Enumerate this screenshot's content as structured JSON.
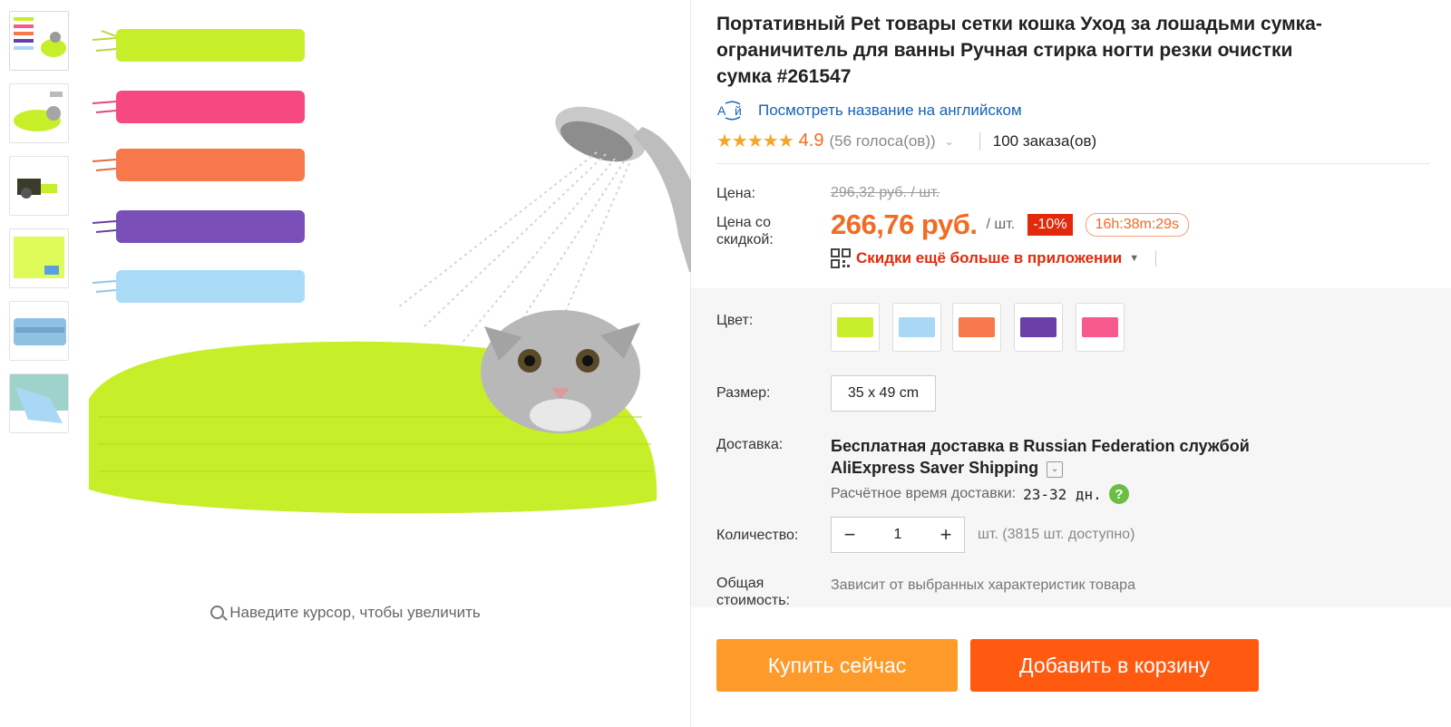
{
  "gallery": {
    "zoom_hint": "Наведите курсор, чтобы увеличить",
    "thumbnail_count": 6
  },
  "product": {
    "title": "Портативный Pet товары сетки кошка Уход за лошадьми сумка-ограничитель для ванны Ручная стирка ногти резки очистки сумка #261547",
    "translate_label": "Посмотреть название на английском",
    "rating_stars": "★★★★★",
    "rating_score": "4.9",
    "rating_votes": "(56 голоса(ов))",
    "orders": "100 заказа(ов)"
  },
  "pricing": {
    "price_label": "Цена:",
    "old_price": "296,32 руб. / шт.",
    "discount_label_line1": "Цена со",
    "discount_label_line2": "скидкой:",
    "price": "266,76 руб.",
    "unit": "/ шт.",
    "discount": "-10%",
    "timer": "16h:38m:29s",
    "app_promo": "Скидки ещё больше в приложении"
  },
  "options": {
    "color_label": "Цвет:",
    "colors": [
      "#c6ef2a",
      "#a9d8f5",
      "#f7784a",
      "#6a3fa8",
      "#f85a8d"
    ],
    "size_label": "Размер:",
    "size_value": "35 x 49 cm",
    "shipping_label": "Доставка:",
    "shipping_line1": "Бесплатная доставка в Russian Federation службой",
    "shipping_line2": "AliExpress Saver Shipping",
    "delivery_time_label": "Расчётное время доставки:",
    "delivery_time_value": "23-32 дн.",
    "quantity_label": "Количество:",
    "quantity_value": "1",
    "quantity_available": "шт. (3815 шт. доступно)",
    "total_label_line1": "Общая",
    "total_label_line2": "стоимость:",
    "total_value": "Зависит от выбранных характеристик товара"
  },
  "actions": {
    "buy_now": "Купить сейчас",
    "add_to_cart": "Добавить в корзину"
  },
  "colors": {
    "accent_orange": "#f26b22",
    "link_blue": "#1462b8",
    "discount_red": "#e3290b",
    "buy_button": "#fd9a2a",
    "cart_button": "#ff5a10"
  }
}
